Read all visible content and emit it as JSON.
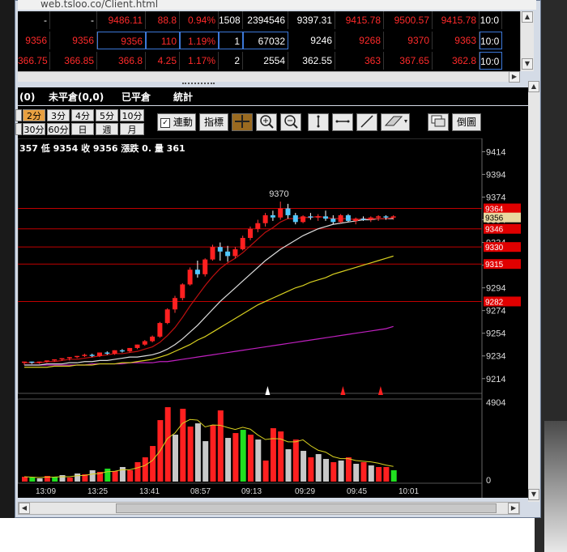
{
  "browser": {
    "url": "web.tsloo.co/Client.html"
  },
  "quote_rows": [
    {
      "cells": [
        "-",
        "-",
        "9486.11",
        "88.8",
        "0.94%",
        "1508",
        "2394546",
        "9397.31",
        "9415.78",
        "9500.57",
        "9415.78",
        "10:0"
      ]
    },
    {
      "cells": [
        "9356",
        "9356",
        "9356",
        "110",
        "1.19%",
        "1",
        "67032",
        "9246",
        "9268",
        "9370",
        "9363",
        "10:0"
      ]
    },
    {
      "cells": [
        "366.75",
        "366.85",
        "366.8",
        "4.25",
        "1.17%",
        "2",
        "2554",
        "362.55",
        "363",
        "367.65",
        "362.8",
        "10:0"
      ]
    }
  ],
  "tabs": [
    "(0)",
    "未平倉(0,0)",
    "已平倉",
    "統計"
  ],
  "periods_row1": [
    "2分",
    "3分",
    "4分",
    "5分",
    "10分"
  ],
  "periods_row2": [
    "30分",
    "60分",
    "日",
    "週",
    "月"
  ],
  "active_period": "2分",
  "toolbar": {
    "link_label": "連動",
    "indicator_label": "指標",
    "invert_label": "倒圖"
  },
  "info_line": "357 低 9354 收 9356 漲跌 0. 量 361",
  "chart_data": {
    "type": "candlestick",
    "price_axis": [
      "9414",
      "9394",
      "9374",
      "9354",
      "9334",
      "9314",
      "9294",
      "9274",
      "9254",
      "9234",
      "9214"
    ],
    "volume_axis": [
      "4904",
      "0"
    ],
    "time_axis": [
      "13:09",
      "13:25",
      "13:41",
      "08:57",
      "09:13",
      "09:29",
      "09:45",
      "10:01"
    ],
    "peak_label": "9370",
    "level_lines": [
      {
        "value": 9364,
        "label": "9364",
        "color": "#e00000"
      },
      {
        "value": 9356,
        "label": "9356",
        "color": "#e8d8a0"
      },
      {
        "value": 9346,
        "label": "9346",
        "color": "#e00000"
      },
      {
        "value": 9330,
        "label": "9330",
        "color": "#e00000"
      },
      {
        "value": 9315,
        "label": "9315",
        "color": "#e00000"
      },
      {
        "value": 9282,
        "label": "9282",
        "color": "#e00000"
      }
    ],
    "ylim": [
      9206,
      9420
    ],
    "candles": [
      [
        9228,
        9229,
        9226,
        9229
      ],
      [
        9229,
        9229,
        9227,
        9228
      ],
      [
        9228,
        9229,
        9227,
        9229
      ],
      [
        9229,
        9230,
        9228,
        9230
      ],
      [
        9230,
        9231,
        9229,
        9231
      ],
      [
        9231,
        9232,
        9230,
        9232
      ],
      [
        9232,
        9233,
        9230,
        9233
      ],
      [
        9233,
        9234,
        9232,
        9234
      ],
      [
        9234,
        9236,
        9233,
        9235
      ],
      [
        9235,
        9236,
        9233,
        9234
      ],
      [
        9234,
        9237,
        9233,
        9237
      ],
      [
        9237,
        9238,
        9235,
        9236
      ],
      [
        9236,
        9239,
        9235,
        9239
      ],
      [
        9239,
        9240,
        9237,
        9238
      ],
      [
        9238,
        9241,
        9237,
        9241
      ],
      [
        9241,
        9244,
        9240,
        9244
      ],
      [
        9244,
        9248,
        9243,
        9247
      ],
      [
        9247,
        9252,
        9246,
        9251
      ],
      [
        9251,
        9264,
        9250,
        9263
      ],
      [
        9263,
        9276,
        9262,
        9275
      ],
      [
        9275,
        9287,
        9272,
        9285
      ],
      [
        9285,
        9298,
        9283,
        9297
      ],
      [
        9297,
        9312,
        9296,
        9310
      ],
      [
        9310,
        9318,
        9303,
        9306
      ],
      [
        9306,
        9320,
        9304,
        9319
      ],
      [
        9319,
        9332,
        9318,
        9330
      ],
      [
        9330,
        9334,
        9318,
        9326
      ],
      [
        9326,
        9331,
        9317,
        9322
      ],
      [
        9322,
        9330,
        9320,
        9328
      ],
      [
        9328,
        9340,
        9327,
        9338
      ],
      [
        9338,
        9348,
        9336,
        9346
      ],
      [
        9346,
        9354,
        9343,
        9351
      ],
      [
        9351,
        9360,
        9348,
        9358
      ],
      [
        9358,
        9362,
        9353,
        9356
      ],
      [
        9356,
        9370,
        9354,
        9364
      ],
      [
        9364,
        9368,
        9355,
        9358
      ],
      [
        9358,
        9360,
        9350,
        9352
      ],
      [
        9352,
        9358,
        9351,
        9357
      ],
      [
        9357,
        9360,
        9354,
        9356
      ],
      [
        9356,
        9359,
        9353,
        9357
      ],
      [
        9357,
        9362,
        9353,
        9355
      ],
      [
        9355,
        9358,
        9350,
        9352
      ],
      [
        9352,
        9359,
        9351,
        9358
      ],
      [
        9358,
        9359,
        9352,
        9353
      ],
      [
        9353,
        9356,
        9350,
        9355
      ],
      [
        9355,
        9357,
        9353,
        9354
      ],
      [
        9354,
        9357,
        9352,
        9356
      ],
      [
        9356,
        9358,
        9353,
        9357
      ],
      [
        9357,
        9358,
        9354,
        9356
      ],
      [
        9356,
        9358,
        9354,
        9357
      ]
    ],
    "ma_red": [
      9228,
      9228,
      9228,
      9229,
      9229,
      9230,
      9231,
      9231,
      9232,
      9233,
      9234,
      9235,
      9236,
      9236,
      9237,
      9238,
      9240,
      9242,
      9246,
      9252,
      9259,
      9268,
      9278,
      9287,
      9296,
      9304,
      9311,
      9316,
      9320,
      9325,
      9331,
      9337,
      9343,
      9347,
      9352,
      9355,
      9355,
      9356,
      9356,
      9357,
      9356,
      9355,
      9355,
      9355,
      9354,
      9355,
      9355,
      9355,
      9355,
      9356
    ],
    "ma_white": [
      9226,
      9226,
      9226,
      9227,
      9227,
      9227,
      9228,
      9228,
      9229,
      9229,
      9230,
      9230,
      9231,
      9232,
      9233,
      9233,
      9234,
      9235,
      9237,
      9240,
      9244,
      9249,
      9255,
      9261,
      9268,
      9275,
      9282,
      9288,
      9294,
      9300,
      9306,
      9312,
      9318,
      9323,
      9328,
      9332,
      9336,
      9340,
      9343,
      9346,
      9348,
      9350,
      9351,
      9352,
      9353,
      9354,
      9354,
      9355,
      9355,
      9355
    ],
    "ma_yellow": [
      9224,
      9224,
      9224,
      9224,
      9225,
      9225,
      9225,
      9226,
      9226,
      9226,
      9227,
      9227,
      9227,
      9228,
      9228,
      9229,
      9230,
      9231,
      9233,
      9235,
      9238,
      9241,
      9244,
      9248,
      9251,
      9255,
      9259,
      9263,
      9267,
      9271,
      9275,
      9279,
      9282,
      9285,
      9288,
      9291,
      9294,
      9296,
      9299,
      9301,
      9303,
      9306,
      9308,
      9310,
      9312,
      9314,
      9316,
      9318,
      9320,
      9322
    ],
    "ma_magenta": [
      9226,
      9226,
      9226,
      9226,
      9226,
      9226,
      9226,
      9226,
      9226,
      9227,
      9227,
      9227,
      9227,
      9227,
      9228,
      9228,
      9228,
      9228,
      9229,
      9229,
      9230,
      9231,
      9232,
      9233,
      9234,
      9235,
      9236,
      9237,
      9238,
      9239,
      9240,
      9241,
      9242,
      9243,
      9244,
      9245,
      9246,
      9247,
      9248,
      9249,
      9250,
      9251,
      9252,
      9253,
      9254,
      9255,
      9256,
      9257,
      9258,
      9260
    ],
    "volumes": [
      300,
      250,
      200,
      350,
      300,
      400,
      250,
      500,
      450,
      700,
      600,
      800,
      650,
      900,
      700,
      1200,
      1500,
      2200,
      3800,
      4600,
      2900,
      4500,
      3400,
      3600,
      2500,
      3500,
      4400,
      2700,
      3000,
      3200,
      2900,
      2600,
      1300,
      3300,
      3100,
      2000,
      2600,
      1900,
      1500,
      1700,
      1400,
      1200,
      1300,
      1500,
      1100,
      1200,
      1000,
      900,
      900,
      700
    ],
    "volume_colors": [
      "r",
      "g",
      "w",
      "r",
      "g",
      "w",
      "r",
      "w",
      "r",
      "w",
      "r",
      "g",
      "r",
      "w",
      "r",
      "r",
      "r",
      "r",
      "r",
      "r",
      "w",
      "r",
      "r",
      "w",
      "w",
      "r",
      "r",
      "w",
      "r",
      "g",
      "r",
      "w",
      "r",
      "r",
      "r",
      "w",
      "r",
      "w",
      "r",
      "w",
      "w",
      "r",
      "w",
      "r",
      "w",
      "r",
      "w",
      "r",
      "r",
      "g"
    ],
    "markers": [
      {
        "index": 28,
        "color": "#ffffff"
      },
      {
        "index": 38,
        "color": "#ff2020"
      },
      {
        "index": 43,
        "color": "#ff2020"
      }
    ]
  }
}
